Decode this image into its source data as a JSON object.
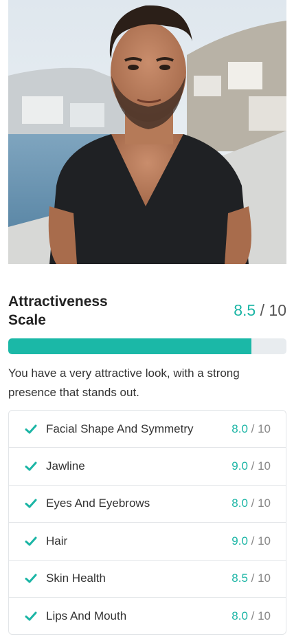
{
  "photo": {
    "icon": "portrait-photo"
  },
  "overall": {
    "title": "Attractiveness Scale",
    "score": "8.5",
    "max": "/ 10",
    "fraction": 0.875,
    "description": "You have a very attractive look, with a strong presence that stands out."
  },
  "criteria": [
    {
      "label": "Facial Shape And Symmetry",
      "score": "8.0",
      "max": "/ 10"
    },
    {
      "label": "Jawline",
      "score": "9.0",
      "max": "/ 10"
    },
    {
      "label": "Eyes And Eyebrows",
      "score": "8.0",
      "max": "/ 10"
    },
    {
      "label": "Hair",
      "score": "9.0",
      "max": "/ 10"
    },
    {
      "label": "Skin Health",
      "score": "8.5",
      "max": "/ 10"
    },
    {
      "label": "Lips And Mouth",
      "score": "8.0",
      "max": "/ 10"
    }
  ],
  "colors": {
    "accent": "#1bb5a5",
    "track": "#e8ecef"
  }
}
